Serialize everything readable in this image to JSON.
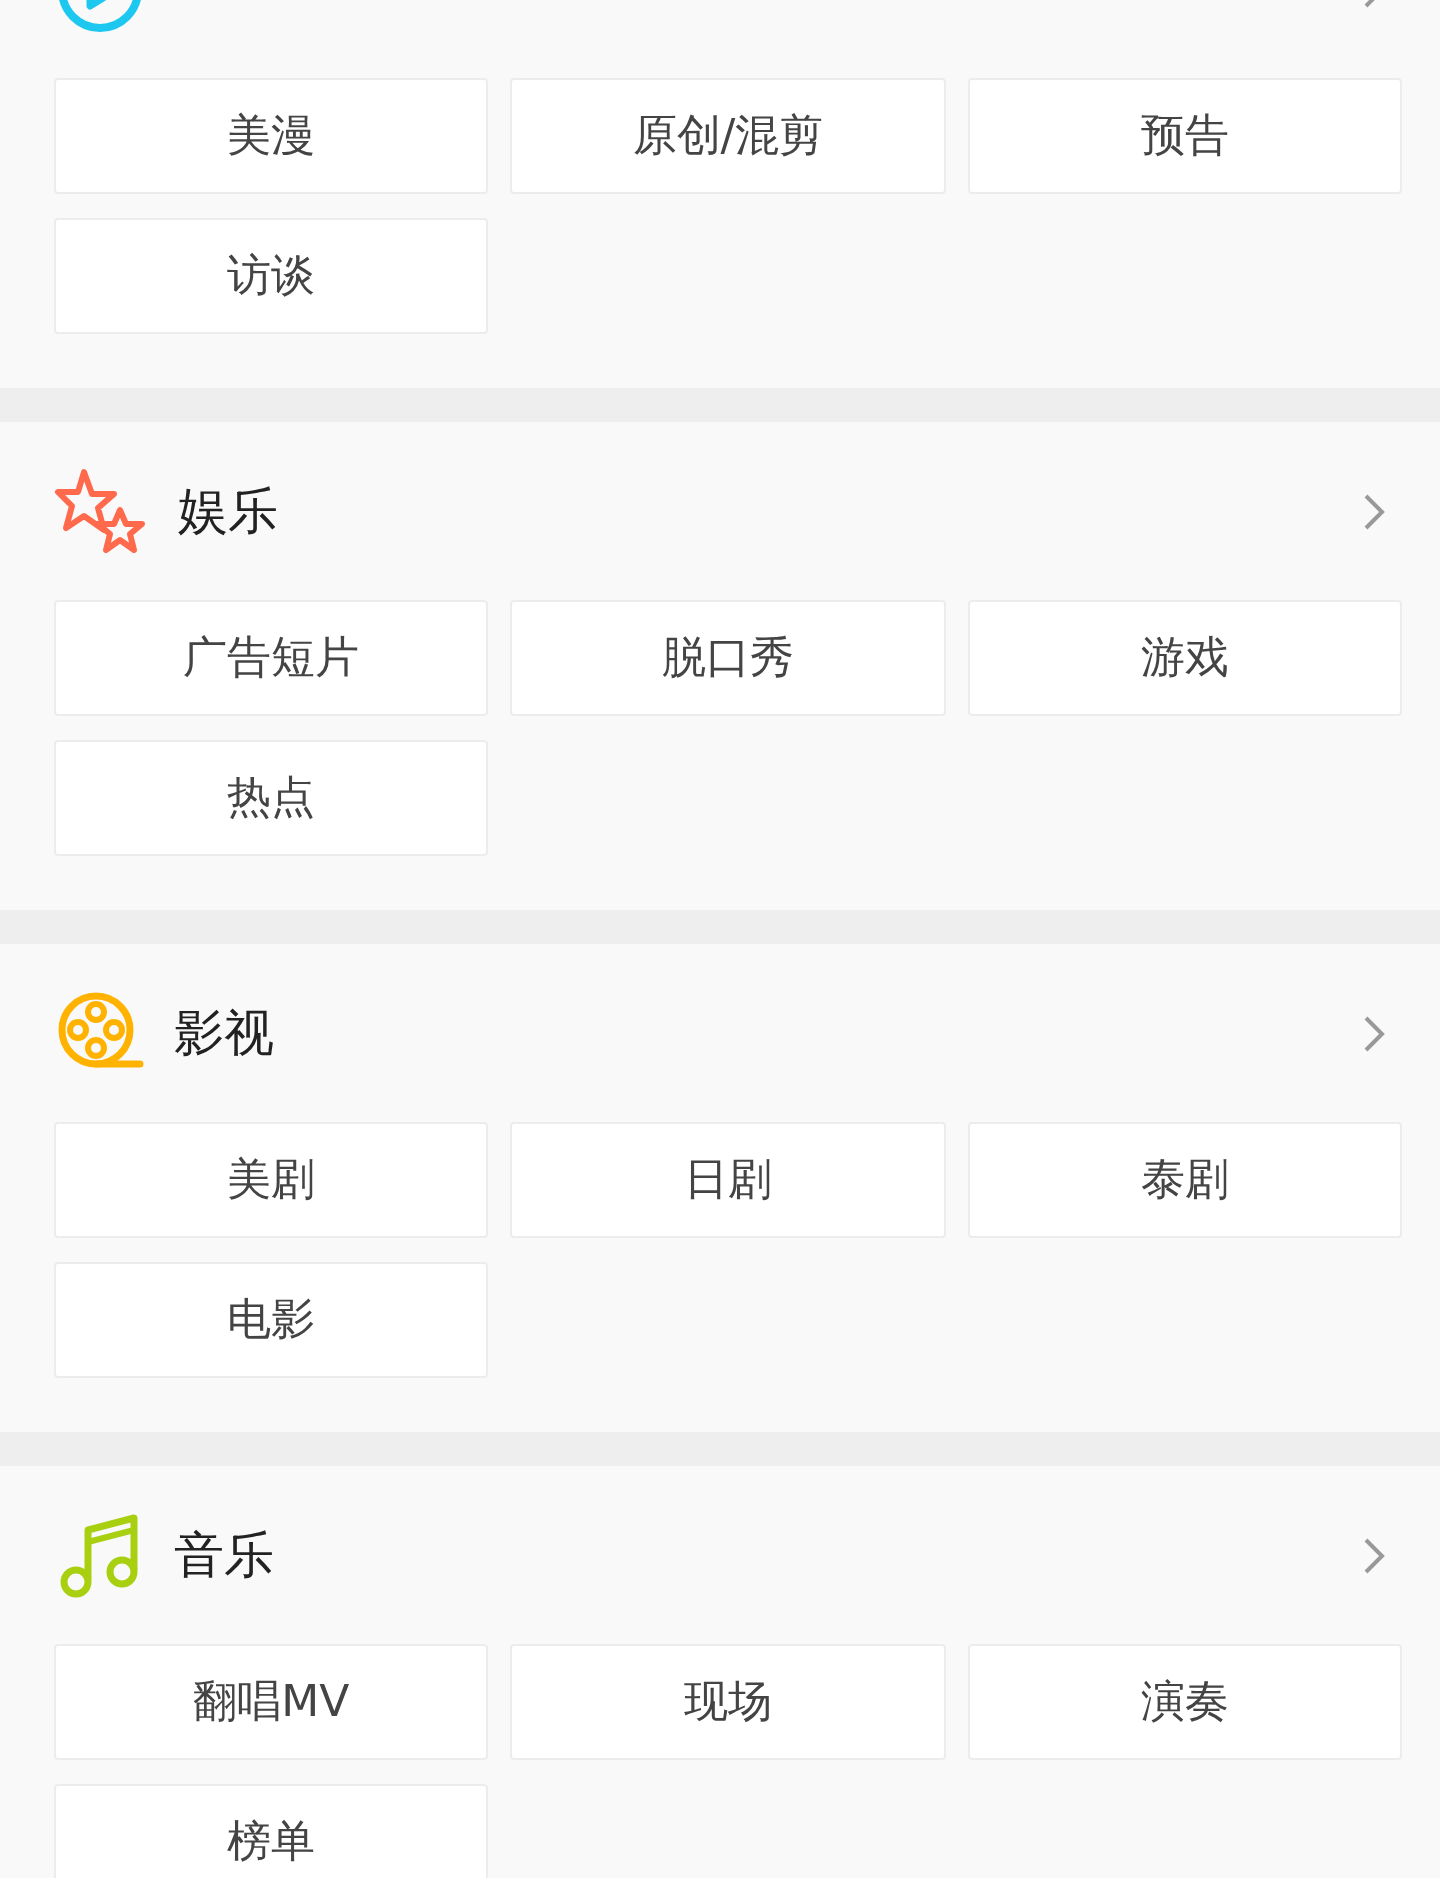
{
  "sections": [
    {
      "tags": [
        "美漫",
        "原创/混剪",
        "预告",
        "访谈"
      ]
    },
    {
      "title": "娱乐",
      "tags": [
        "广告短片",
        "脱口秀",
        "游戏",
        "热点"
      ]
    },
    {
      "title": "影视",
      "tags": [
        "美剧",
        "日剧",
        "泰剧",
        "电影"
      ]
    },
    {
      "title": "音乐",
      "tags": [
        "翻唱MV",
        "现场",
        "演奏",
        "榜单"
      ]
    }
  ]
}
